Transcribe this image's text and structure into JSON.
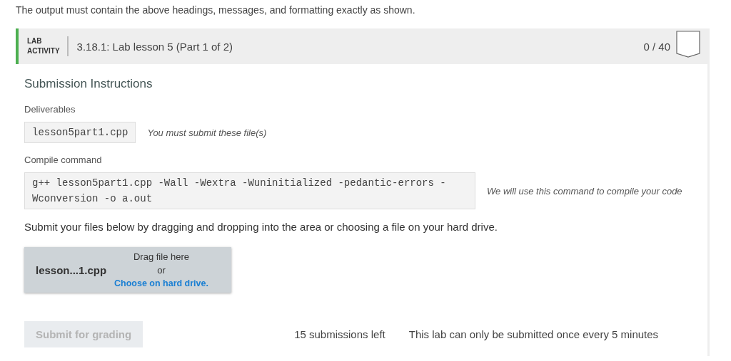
{
  "intro": "The output must contain the above headings, messages, and formatting exactly as shown.",
  "activity": {
    "kind_label_1": "LAB",
    "kind_label_2": "ACTIVITY",
    "title": "3.18.1: Lab lesson 5 (Part 1 of 2)",
    "score": "0 / 40"
  },
  "heading": "Submission Instructions",
  "deliverables": {
    "label": "Deliverables",
    "file": "lesson5part1.cpp",
    "note": "You must submit these file(s)"
  },
  "compile": {
    "label": "Compile command",
    "command": "g++ lesson5part1.cpp -Wall -Wextra -Wuninitialized -pedantic-errors -Wconversion -o a.out",
    "note": "We will use this command to compile your code"
  },
  "instructions": "Submit your files below by dragging and dropping into the area or choosing a file on your hard drive.",
  "dropzone": {
    "file": "lesson...1.cpp",
    "drag": "Drag file here",
    "or": "or",
    "choose": "Choose on hard drive."
  },
  "submit": {
    "label": "Submit for grading",
    "disabled": true
  },
  "submissions_left": "15 submissions left",
  "rate_note": "This lab can only be submitted once every 5 minutes"
}
